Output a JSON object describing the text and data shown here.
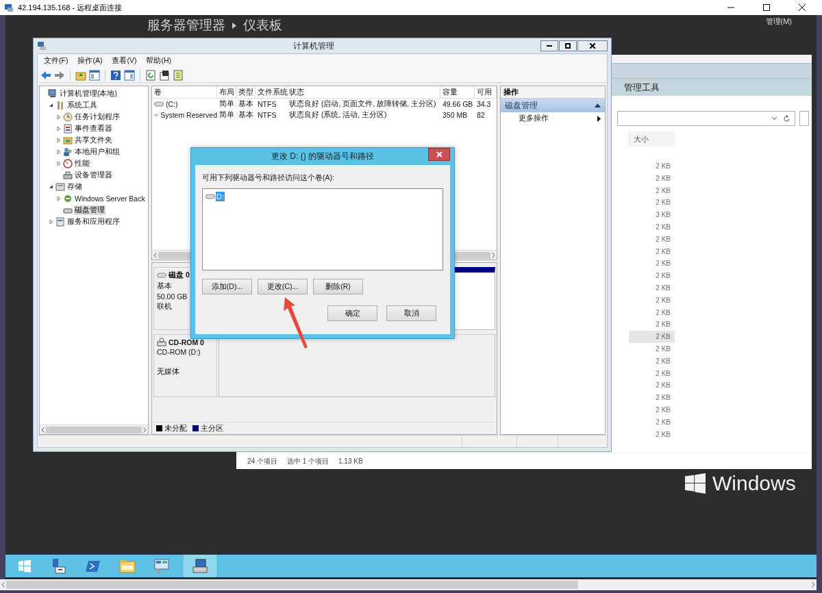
{
  "rdp_window": {
    "title": "42.194.135.168 - 远程桌面连接"
  },
  "server_manager": {
    "breadcrumb": [
      "服务器管理器",
      "仪表板"
    ],
    "menu": "管理(M)"
  },
  "explorer": {
    "header": "管理工具",
    "size_column": "大小",
    "sizes": [
      {
        "text": "2 KB",
        "selected": false
      },
      {
        "text": "2 KB",
        "selected": false
      },
      {
        "text": "2 KB",
        "selected": false
      },
      {
        "text": "2 KB",
        "selected": false
      },
      {
        "text": "3 KB",
        "selected": false
      },
      {
        "text": "2 KB",
        "selected": false
      },
      {
        "text": "2 KB",
        "selected": false
      },
      {
        "text": "2 KB",
        "selected": false
      },
      {
        "text": "2 KB",
        "selected": false
      },
      {
        "text": "2 KB",
        "selected": false
      },
      {
        "text": "2 KB",
        "selected": false
      },
      {
        "text": "2 KB",
        "selected": false
      },
      {
        "text": "2 KB",
        "selected": false
      },
      {
        "text": "2 KB",
        "selected": false
      },
      {
        "text": "2 KB",
        "selected": true
      },
      {
        "text": "2 KB",
        "selected": false
      },
      {
        "text": "2 KB",
        "selected": false
      },
      {
        "text": "2 KB",
        "selected": false
      },
      {
        "text": "2 KB",
        "selected": false
      },
      {
        "text": "2 KB",
        "selected": false
      },
      {
        "text": "2 KB",
        "selected": false
      },
      {
        "text": "2 KB",
        "selected": false
      },
      {
        "text": "2 KB",
        "selected": false
      }
    ],
    "status": [
      "24 个项目",
      "选中 1 个项目",
      "1.13 KB"
    ]
  },
  "desktop_logo": "Windows",
  "computer_management": {
    "title": "计算机管理",
    "menu": [
      "文件(F)",
      "操作(A)",
      "查看(V)",
      "帮助(H)"
    ],
    "tree": [
      {
        "label": "计算机管理(本地)",
        "kind": "computer",
        "selected": false,
        "children": [
          {
            "label": "系统工具",
            "kind": "tools",
            "expanded": true,
            "selected": false,
            "children": [
              {
                "label": "任务计划程序",
                "kind": "clock",
                "expanded": false,
                "selected": false
              },
              {
                "label": "事件查看器",
                "kind": "log",
                "expanded": false,
                "selected": false
              },
              {
                "label": "共享文件夹",
                "kind": "folder",
                "expanded": false,
                "selected": false
              },
              {
                "label": "本地用户和组",
                "kind": "users",
                "expanded": false,
                "selected": false
              },
              {
                "label": "性能",
                "kind": "gauge",
                "expanded": false,
                "selected": false
              },
              {
                "label": "设备管理器",
                "kind": "device",
                "selected": false
              }
            ]
          },
          {
            "label": "存储",
            "kind": "storage",
            "expanded": true,
            "selected": false,
            "children": [
              {
                "label": "Windows Server Back",
                "kind": "backup",
                "expanded": false,
                "selected": false
              },
              {
                "label": "磁盘管理",
                "kind": "disk",
                "selected": true
              }
            ]
          },
          {
            "label": "服务和应用程序",
            "kind": "services",
            "expanded": false,
            "selected": false
          }
        ]
      }
    ],
    "volumes": {
      "columns": [
        "卷",
        "布局",
        "类型",
        "文件系统",
        "状态",
        "容量",
        "可用"
      ],
      "rows": [
        [
          "(C:)",
          "简单",
          "基本",
          "NTFS",
          "状态良好 (启动, 页面文件, 故障转储, 主分区)",
          "49.66 GB",
          "34.3"
        ],
        [
          "System Reserved",
          "简单",
          "基本",
          "NTFS",
          "状态良好 (系统, 活动, 主分区)",
          "350 MB",
          "82"
        ]
      ]
    },
    "disks": [
      {
        "name": "磁盘 0",
        "kind": "disk",
        "lines": [
          "基本",
          "50.00 GB",
          "联机"
        ]
      },
      {
        "name": "CD-ROM 0",
        "kind": "cdrom",
        "lines": [
          "CD-ROM (D:)",
          "无媒体"
        ]
      }
    ],
    "legend": [
      {
        "label": "未分配",
        "color": "#000000"
      },
      {
        "label": "主分区",
        "color": "#000080"
      }
    ],
    "actions": {
      "header": "操作",
      "section": "磁盘管理",
      "items": [
        "更多操作"
      ]
    }
  },
  "dialog": {
    "title": "更改 D: () 的驱动器号和路径",
    "prompt": "可用下列驱动器号和路径访问这个卷(A):",
    "paths": [
      {
        "label": "D:",
        "selected": true
      }
    ],
    "buttons": [
      "添加(D)...",
      "更改(C)...",
      "删除(R)"
    ],
    "footer_buttons": [
      "确定",
      "取消"
    ]
  },
  "taskbar": {
    "apps": [
      {
        "kind": "start",
        "selected": false
      },
      {
        "kind": "server",
        "selected": false
      },
      {
        "kind": "shell",
        "selected": false
      },
      {
        "kind": "folder",
        "selected": false
      },
      {
        "kind": "panel",
        "selected": false
      },
      {
        "kind": "computer",
        "selected": true
      }
    ]
  }
}
